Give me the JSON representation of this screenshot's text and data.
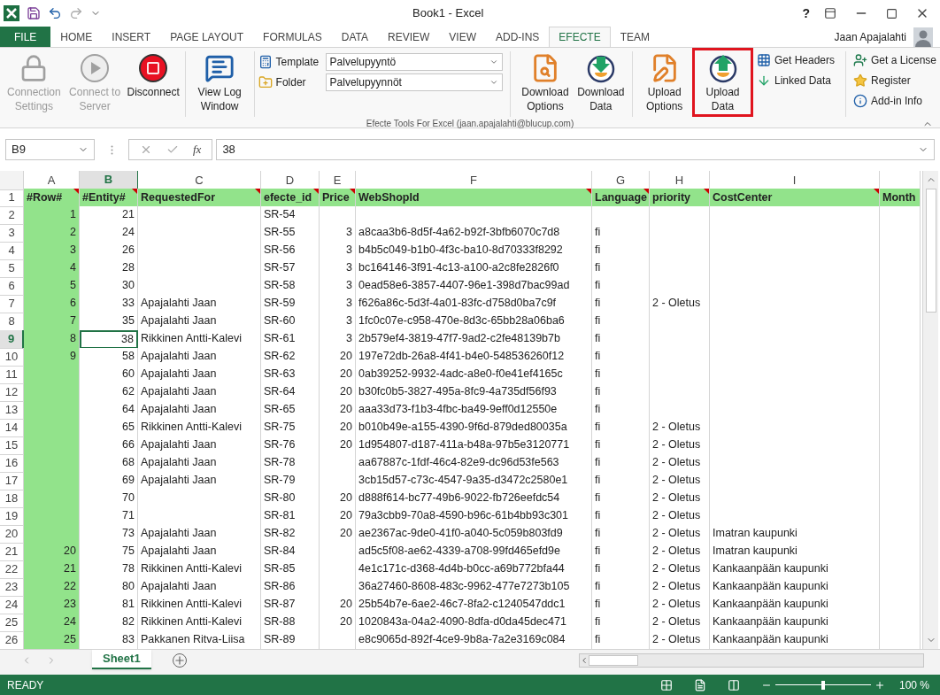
{
  "window": {
    "title": "Book1 - Excel",
    "help": "?"
  },
  "ribbon_tabs": [
    {
      "label": "FILE",
      "kind": "file",
      "selected": false
    },
    {
      "label": "HOME",
      "kind": "tab",
      "selected": false
    },
    {
      "label": "INSERT",
      "kind": "tab",
      "selected": false
    },
    {
      "label": "PAGE LAYOUT",
      "kind": "tab",
      "selected": false
    },
    {
      "label": "FORMULAS",
      "kind": "tab",
      "selected": false
    },
    {
      "label": "DATA",
      "kind": "tab",
      "selected": false
    },
    {
      "label": "REVIEW",
      "kind": "tab",
      "selected": false
    },
    {
      "label": "VIEW",
      "kind": "tab",
      "selected": false
    },
    {
      "label": "ADD-INS",
      "kind": "tab",
      "selected": false
    },
    {
      "label": "EFECTE",
      "kind": "tab",
      "selected": true
    },
    {
      "label": "TEAM",
      "kind": "tab",
      "selected": false
    }
  ],
  "user": "Jaan Apajalahti",
  "ribbon": {
    "group_label": "Efecte Tools For Excel (jaan.apajalahti@blucup.com)",
    "connection_buttons": [
      {
        "label": "Connection Settings",
        "disabled": true
      },
      {
        "label": "Connect to Server",
        "disabled": true
      },
      {
        "label": "Disconnect",
        "disabled": false
      },
      {
        "label": "View Log Window",
        "disabled": false
      }
    ],
    "selectors": [
      {
        "label": "Template",
        "value": "Palvelupyyntö"
      },
      {
        "label": "Folder",
        "value": "Palvelupyynnöt"
      }
    ],
    "data_buttons": [
      {
        "label": "Download Options",
        "highlighted": false
      },
      {
        "label": "Download Data",
        "highlighted": false
      },
      {
        "label": "Upload Options",
        "highlighted": false
      },
      {
        "label": "Upload Data",
        "highlighted": true
      }
    ],
    "small_buttons": [
      {
        "label": "Get Headers"
      },
      {
        "label": "Linked Data"
      }
    ],
    "info_buttons": [
      {
        "label": "Get a License"
      },
      {
        "label": "Register"
      },
      {
        "label": "Add-in Info"
      }
    ]
  },
  "formula_bar": {
    "name_box": "B9",
    "fx": "fx",
    "value": "38"
  },
  "columns": [
    {
      "letter": "A",
      "selected": false,
      "filled": true
    },
    {
      "letter": "B",
      "selected": true,
      "filled": false
    },
    {
      "letter": "C",
      "selected": false,
      "filled": false
    },
    {
      "letter": "D",
      "selected": false,
      "filled": false
    },
    {
      "letter": "E",
      "selected": false,
      "filled": false
    },
    {
      "letter": "F",
      "selected": false,
      "filled": false
    },
    {
      "letter": "G",
      "selected": false,
      "filled": false
    },
    {
      "letter": "H",
      "selected": false,
      "filled": false
    },
    {
      "letter": "I",
      "selected": false,
      "filled": false
    },
    {
      "selected": false,
      "filled": false
    }
  ],
  "rows": [
    {
      "num": "1",
      "kind": "header",
      "selected": false,
      "cells": [
        "#Row#",
        "#Entity#",
        "RequestedFor",
        "efecte_id",
        "Price",
        "WebShopId",
        "Language",
        "priority",
        "CostCenter",
        "Month"
      ]
    },
    {
      "num": "2",
      "kind": "data",
      "selected": false,
      "cells": [
        "1",
        "21",
        null,
        "SR-54",
        null,
        null,
        null,
        null,
        null,
        null
      ]
    },
    {
      "num": "3",
      "kind": "data",
      "selected": false,
      "cells": [
        "2",
        "24",
        null,
        "SR-55",
        "3",
        "a8caa3b6-8d5f-4a62-b92f-3bfb6070c7d8",
        "fi",
        null,
        null,
        null
      ]
    },
    {
      "num": "4",
      "kind": "data",
      "selected": false,
      "cells": [
        "3",
        "26",
        null,
        "SR-56",
        "3",
        "b4b5c049-b1b0-4f3c-ba10-8d70333f8292",
        "fi",
        null,
        null,
        null
      ]
    },
    {
      "num": "5",
      "kind": "data",
      "selected": false,
      "cells": [
        "4",
        "28",
        null,
        "SR-57",
        "3",
        "bc164146-3f91-4c13-a100-a2c8fe2826f0",
        "fi",
        null,
        null,
        null
      ]
    },
    {
      "num": "6",
      "kind": "data",
      "selected": false,
      "cells": [
        "5",
        "30",
        null,
        "SR-58",
        "3",
        "0ead58e6-3857-4407-96e1-398d7bac99ad",
        "fi",
        null,
        null,
        null
      ]
    },
    {
      "num": "7",
      "kind": "data",
      "selected": false,
      "cells": [
        "6",
        "33",
        "Apajalahti Jaan",
        "SR-59",
        "3",
        "f626a86c-5d3f-4a01-83fc-d758d0ba7c9f",
        "fi",
        "2 - Oletus",
        null,
        null
      ]
    },
    {
      "num": "8",
      "kind": "data",
      "selected": false,
      "cells": [
        "7",
        "35",
        "Apajalahti Jaan",
        "SR-60",
        "3",
        "1fc0c07e-c958-470e-8d3c-65bb28a06ba6",
        "fi",
        null,
        null,
        null
      ]
    },
    {
      "num": "9",
      "kind": "data",
      "selected": true,
      "cells": [
        "8",
        "38",
        "Rikkinen Antti-Kalevi",
        "SR-61",
        "3",
        "2b579ef4-3819-47f7-9ad2-c2fe48139b7b",
        "fi",
        null,
        null,
        null
      ]
    },
    {
      "num": "10",
      "kind": "data",
      "selected": false,
      "cells": [
        "9",
        "58",
        "Apajalahti Jaan",
        "SR-62",
        "20",
        "197e72db-26a8-4f41-b4e0-548536260f12",
        "fi",
        null,
        null,
        null
      ]
    },
    {
      "num": "11",
      "kind": "data",
      "selected": false,
      "cells": [
        null,
        "60",
        "Apajalahti Jaan",
        "SR-63",
        "20",
        "0ab39252-9932-4adc-a8e0-f0e41ef4165c",
        "fi",
        null,
        null,
        null
      ]
    },
    {
      "num": "12",
      "kind": "data",
      "selected": false,
      "cells": [
        null,
        "62",
        "Apajalahti Jaan",
        "SR-64",
        "20",
        "b30fc0b5-3827-495a-8fc9-4a735df56f93",
        "fi",
        null,
        null,
        null
      ]
    },
    {
      "num": "13",
      "kind": "data",
      "selected": false,
      "cells": [
        null,
        "64",
        "Apajalahti Jaan",
        "SR-65",
        "20",
        "aaa33d73-f1b3-4fbc-ba49-9eff0d12550e",
        "fi",
        null,
        null,
        null
      ]
    },
    {
      "num": "14",
      "kind": "data",
      "selected": false,
      "cells": [
        null,
        "65",
        "Rikkinen Antti-Kalevi",
        "SR-75",
        "20",
        "b010b49e-a155-4390-9f6d-879ded80035a",
        "fi",
        "2 - Oletus",
        null,
        null
      ]
    },
    {
      "num": "15",
      "kind": "data",
      "selected": false,
      "cells": [
        null,
        "66",
        "Apajalahti Jaan",
        "SR-76",
        "20",
        "1d954807-d187-411a-b48a-97b5e3120771",
        "fi",
        "2 - Oletus",
        null,
        null
      ]
    },
    {
      "num": "16",
      "kind": "data",
      "selected": false,
      "cells": [
        null,
        "68",
        "Apajalahti Jaan",
        "SR-78",
        null,
        "aa67887c-1fdf-46c4-82e9-dc96d53fe563",
        "fi",
        "2 - Oletus",
        null,
        null
      ]
    },
    {
      "num": "17",
      "kind": "data",
      "selected": false,
      "cells": [
        null,
        "69",
        "Apajalahti Jaan",
        "SR-79",
        null,
        "3cb15d57-c73c-4547-9a35-d3472c2580e1",
        "fi",
        "2 - Oletus",
        null,
        null
      ]
    },
    {
      "num": "18",
      "kind": "data",
      "selected": false,
      "cells": [
        null,
        "70",
        null,
        "SR-80",
        "20",
        "d888f614-bc77-49b6-9022-fb726eefdc54",
        "fi",
        "2 - Oletus",
        null,
        null
      ]
    },
    {
      "num": "19",
      "kind": "data",
      "selected": false,
      "cells": [
        null,
        "71",
        null,
        "SR-81",
        "20",
        "79a3cbb9-70a8-4590-b96c-61b4bb93c301",
        "fi",
        "2 - Oletus",
        null,
        null
      ]
    },
    {
      "num": "20",
      "kind": "data",
      "selected": false,
      "cells": [
        null,
        "73",
        "Apajalahti Jaan",
        "SR-82",
        "20",
        "ae2367ac-9de0-41f0-a040-5c059b803fd9",
        "fi",
        "2 - Oletus",
        "Imatran kaupunki",
        null
      ]
    },
    {
      "num": "21",
      "kind": "data",
      "selected": false,
      "cells": [
        "20",
        "75",
        "Apajalahti Jaan",
        "SR-84",
        null,
        "ad5c5f08-ae62-4339-a708-99fd465efd9e",
        "fi",
        "2 - Oletus",
        "Imatran kaupunki",
        null
      ]
    },
    {
      "num": "22",
      "kind": "data",
      "selected": false,
      "cells": [
        "21",
        "78",
        "Rikkinen Antti-Kalevi",
        "SR-85",
        null,
        "4e1c171c-d368-4d4b-b0cc-a69b772bfa44",
        "fi",
        "2 - Oletus",
        "Kankaanpään kaupunki",
        null
      ]
    },
    {
      "num": "23",
      "kind": "data",
      "selected": false,
      "cells": [
        "22",
        "80",
        "Apajalahti Jaan",
        "SR-86",
        null,
        "36a27460-8608-483c-9962-477e7273b105",
        "fi",
        "2 - Oletus",
        "Kankaanpään kaupunki",
        null
      ]
    },
    {
      "num": "24",
      "kind": "data",
      "selected": false,
      "cells": [
        "23",
        "81",
        "Rikkinen Antti-Kalevi",
        "SR-87",
        "20",
        "25b54b7e-6ae2-46c7-8fa2-c1240547ddc1",
        "fi",
        "2 - Oletus",
        "Kankaanpään kaupunki",
        null
      ]
    },
    {
      "num": "25",
      "kind": "data",
      "selected": false,
      "cells": [
        "24",
        "82",
        "Rikkinen Antti-Kalevi",
        "SR-88",
        "20",
        "1020843a-04a2-4090-8dfa-d0da45dec471",
        "fi",
        "2 - Oletus",
        "Kankaanpään kaupunki",
        null
      ]
    },
    {
      "num": "26",
      "kind": "data",
      "selected": false,
      "cells": [
        "25",
        "83",
        "Pakkanen Ritva-Liisa",
        "SR-89",
        null,
        "e8c9065d-892f-4ce9-9b8a-7a2e3169c084",
        "fi",
        "2 - Oletus",
        "Kankaanpään kaupunki",
        null
      ]
    }
  ],
  "sheet_tabs": [
    {
      "label": "Sheet1",
      "selected": true
    }
  ],
  "status_bar": {
    "status": "READY",
    "zoom": {
      "level": 0.5,
      "reading": "100 %"
    }
  }
}
